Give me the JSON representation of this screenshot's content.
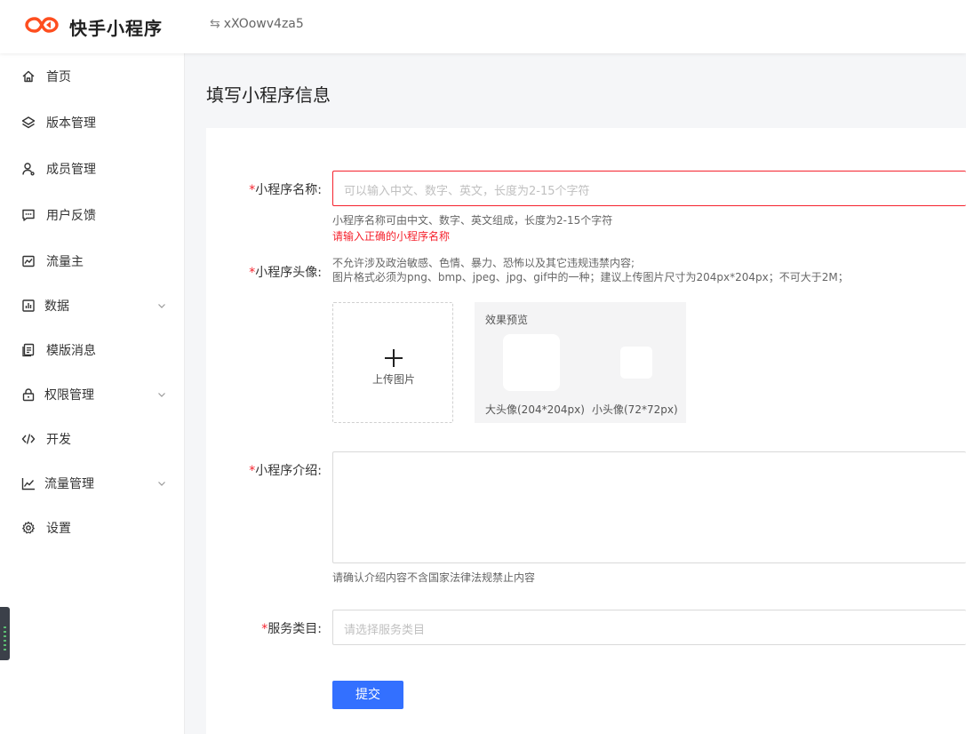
{
  "header": {
    "brand": "快手小程序",
    "app_id": "xXOowv4za5",
    "brand_color": "#fe4e1f"
  },
  "sidebar": {
    "items": [
      {
        "label": "首页",
        "icon": "home-icon"
      },
      {
        "label": "版本管理",
        "icon": "layers-icon"
      },
      {
        "label": "成员管理",
        "icon": "user-icon"
      },
      {
        "label": "用户反馈",
        "icon": "message-icon"
      },
      {
        "label": "流量主",
        "icon": "traffic-icon"
      },
      {
        "label": "数据",
        "icon": "bar-chart-icon",
        "expandable": true
      },
      {
        "label": "模版消息",
        "icon": "template-icon"
      },
      {
        "label": "权限管理",
        "icon": "lock-icon",
        "expandable": true
      },
      {
        "label": "开发",
        "icon": "code-icon"
      },
      {
        "label": "流量管理",
        "icon": "line-chart-icon",
        "expandable": true
      },
      {
        "label": "设置",
        "icon": "gear-icon"
      }
    ]
  },
  "page": {
    "title": "填写小程序信息"
  },
  "form": {
    "required_mark": "*",
    "name": {
      "label": "小程序名称:",
      "placeholder": "可以输入中文、数字、英文，长度为2-15个字符",
      "value": "",
      "help": "小程序名称可由中文、数字、英文组成，长度为2-15个字符",
      "error": "请输入正确的小程序名称"
    },
    "avatar": {
      "label": "小程序头像:",
      "help_line1": "不允许涉及政治敏感、色情、暴力、恐怖以及其它违规违禁内容;",
      "help_line2": "图片格式必须为png、bmp、jpeg、jpg、gif中的一种；建议上传图片尺寸为204px*204px；不可大于2M；",
      "upload_label": "上传图片",
      "preview_title": "效果预览",
      "big_label": "大头像(204*204px)",
      "small_label": "小头像(72*72px)"
    },
    "intro": {
      "label": "小程序介绍:",
      "value": "",
      "help": "请确认介绍内容不含国家法律法规禁止内容"
    },
    "category": {
      "label": "服务类目:",
      "placeholder": "请选择服务类目"
    },
    "submit_label": "提交",
    "accent_color": "#3370ff",
    "error_color": "#f5222d"
  }
}
